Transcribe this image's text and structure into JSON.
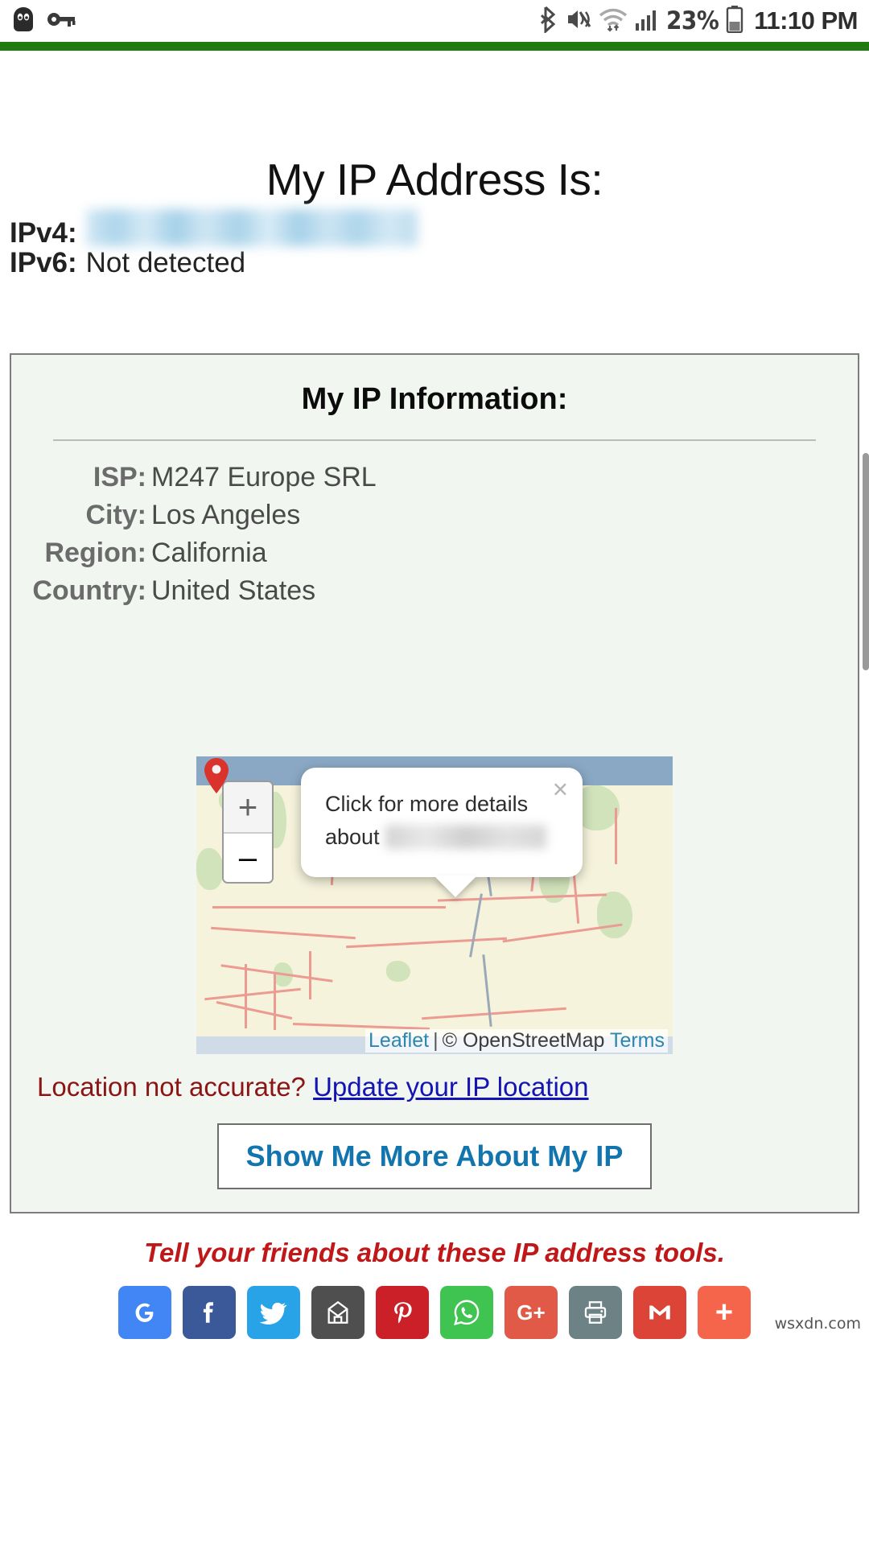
{
  "statusbar": {
    "icons_left": [
      "cyberghost-vpn-icon",
      "vpn-key-icon"
    ],
    "icons_right": [
      "bluetooth-icon",
      "mute-vibrate-icon",
      "wifi-icon",
      "cellular-signal-icon",
      "battery-icon"
    ],
    "battery_percent": "23%",
    "time": "11:10 PM"
  },
  "theme": {
    "accent_green": "#1f7a10",
    "card_bg": "#f1f6f1",
    "link_blue": "#1414b4",
    "button_blue": "#1275ad",
    "warn_red": "#8b1515",
    "footer_red": "#c01818"
  },
  "page": {
    "title": "My IP Address Is:",
    "ip_rows": [
      {
        "label": "IPv4:",
        "value": "",
        "redacted": true
      },
      {
        "label": "IPv6:",
        "value": "Not detected",
        "redacted": false
      }
    ]
  },
  "card": {
    "heading": "My IP Information:",
    "info": [
      {
        "key": "ISP:",
        "value": "M247 Europe SRL"
      },
      {
        "key": "City:",
        "value": "Los Angeles"
      },
      {
        "key": "Region:",
        "value": "California"
      },
      {
        "key": "Country:",
        "value": "United States"
      }
    ],
    "map": {
      "marker": "location-pin-icon",
      "zoom_in_label": "+",
      "zoom_out_label": "–",
      "popup": {
        "text_line1": "Click for more details",
        "text_line2": "about",
        "redacted_value": "",
        "close_label": "×"
      },
      "attribution": {
        "leaflet": "Leaflet",
        "separator": "|",
        "osm": "© OpenStreetMap",
        "terms": "Terms"
      }
    },
    "not_accurate_text": "Location not accurate?",
    "update_link": "Update your IP location",
    "show_more_button": "Show Me More About My IP"
  },
  "footer": {
    "tagline": "Tell your friends about these IP address tools.",
    "share_buttons": [
      {
        "name": "google-search-share-icon",
        "glyph": "G",
        "color": "#4285f4"
      },
      {
        "name": "facebook-share-icon",
        "glyph": "f",
        "color": "#3b5998"
      },
      {
        "name": "twitter-share-icon",
        "glyph": "🐦",
        "color": "#29a3e8"
      },
      {
        "name": "mailto-share-icon",
        "glyph": "✉",
        "color": "#4f4f4f"
      },
      {
        "name": "pinterest-share-icon",
        "glyph": "𝑷",
        "color": "#cb2027"
      },
      {
        "name": "whatsapp-share-icon",
        "glyph": "✆",
        "color": "#3fc351"
      },
      {
        "name": "google-plus-share-icon",
        "glyph": "G+",
        "color": "#e05a47"
      },
      {
        "name": "print-share-icon",
        "glyph": "⎙",
        "color": "#6d8285"
      },
      {
        "name": "gmail-share-icon",
        "glyph": "M",
        "color": "#db4437"
      },
      {
        "name": "more-share-icon",
        "glyph": "+",
        "color": "#f4654b"
      }
    ],
    "watermark": "wsxdn.com"
  }
}
